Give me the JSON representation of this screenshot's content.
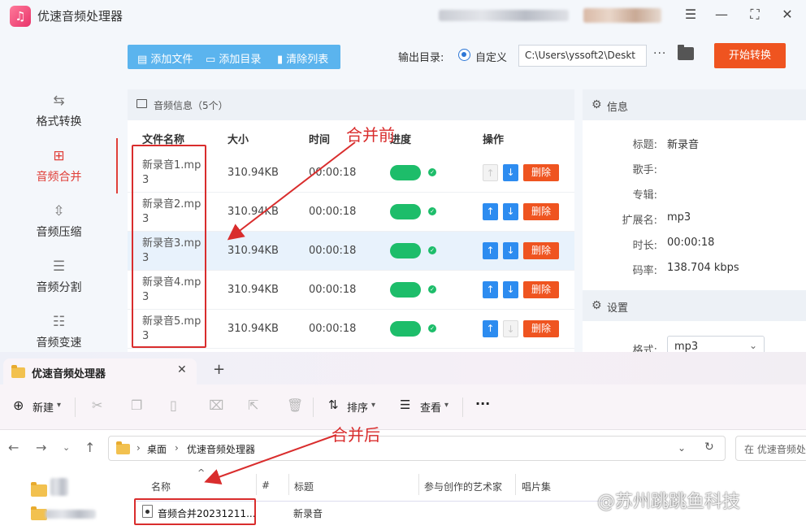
{
  "app": {
    "title": "优速音频处理器",
    "logo_glyph": "♫",
    "window_controls": [
      "☰",
      "—",
      "⛶",
      "✕"
    ]
  },
  "sidebar": {
    "items": [
      {
        "label": "格式转换",
        "icon": "format-convert-icon",
        "glyph": "⇆"
      },
      {
        "label": "音频合并",
        "icon": "merge-icon",
        "glyph": "⊞",
        "active": true
      },
      {
        "label": "音频压缩",
        "icon": "compress-icon",
        "glyph": "⇳"
      },
      {
        "label": "音频分割",
        "icon": "split-icon",
        "glyph": "☰"
      },
      {
        "label": "音频变速",
        "icon": "speed-icon",
        "glyph": "☷"
      }
    ]
  },
  "toolbar": {
    "add_file": "添加文件",
    "add_dir": "添加目录",
    "clear_list": "清除列表",
    "output_label": "输出目录:",
    "radio_label": "自定义",
    "output_path": "C:\\Users\\yssoft2\\Deskt",
    "more": "···",
    "start_button": "开始转换"
  },
  "file_panel": {
    "header": "音频信息（5个）",
    "columns": [
      "文件名称",
      "大小",
      "时间",
      "进度",
      "操作"
    ],
    "delete_label": "删除",
    "rows": [
      {
        "name": "新录音1.mp3",
        "size": "310.94KB",
        "time": "00:00:18"
      },
      {
        "name": "新录音2.mp3",
        "size": "310.94KB",
        "time": "00:00:18"
      },
      {
        "name": "新录音3.mp3",
        "size": "310.94KB",
        "time": "00:00:18"
      },
      {
        "name": "新录音4.mp3",
        "size": "310.94KB",
        "time": "00:00:18"
      },
      {
        "name": "新录音5.mp3",
        "size": "310.94KB",
        "time": "00:00:18"
      }
    ]
  },
  "info_panel": {
    "header": "信息",
    "fields": [
      {
        "key": "标题:",
        "value": "新录音"
      },
      {
        "key": "歌手:",
        "value": ""
      },
      {
        "key": "专辑:",
        "value": ""
      },
      {
        "key": "扩展名:",
        "value": "mp3"
      },
      {
        "key": "时长:",
        "value": "00:00:18"
      },
      {
        "key": "码率:",
        "value": "138.704 kbps"
      }
    ],
    "settings_header": "设置",
    "format_label": "格式:",
    "format_value": "mp3"
  },
  "explorer": {
    "tab_label": "优速音频处理器",
    "tab_close": "✕",
    "tab_add": "+",
    "commands": {
      "new": "新建",
      "sort": "排序",
      "view": "查看",
      "more": "···"
    },
    "breadcrumb": [
      "桌面",
      "优速音频处理器"
    ],
    "search_placeholder": "在 优速音频处",
    "columns": [
      "名称",
      "#",
      "标题",
      "参与创作的艺术家",
      "唱片集"
    ],
    "file": {
      "name": "音频合并20231211...",
      "title": "新录音"
    }
  },
  "annotations": {
    "before": "合并前",
    "after": "合并后",
    "color": "#d92d2d"
  },
  "watermark": "@苏州跳跳鱼科技",
  "colors": {
    "accent_red": "#ef5420",
    "primary_blue": "#2d8cf0",
    "toolbar_blue": "#5bb4ee",
    "toggle_green": "#1dbd6a",
    "active_sidebar": "#e0403a"
  }
}
